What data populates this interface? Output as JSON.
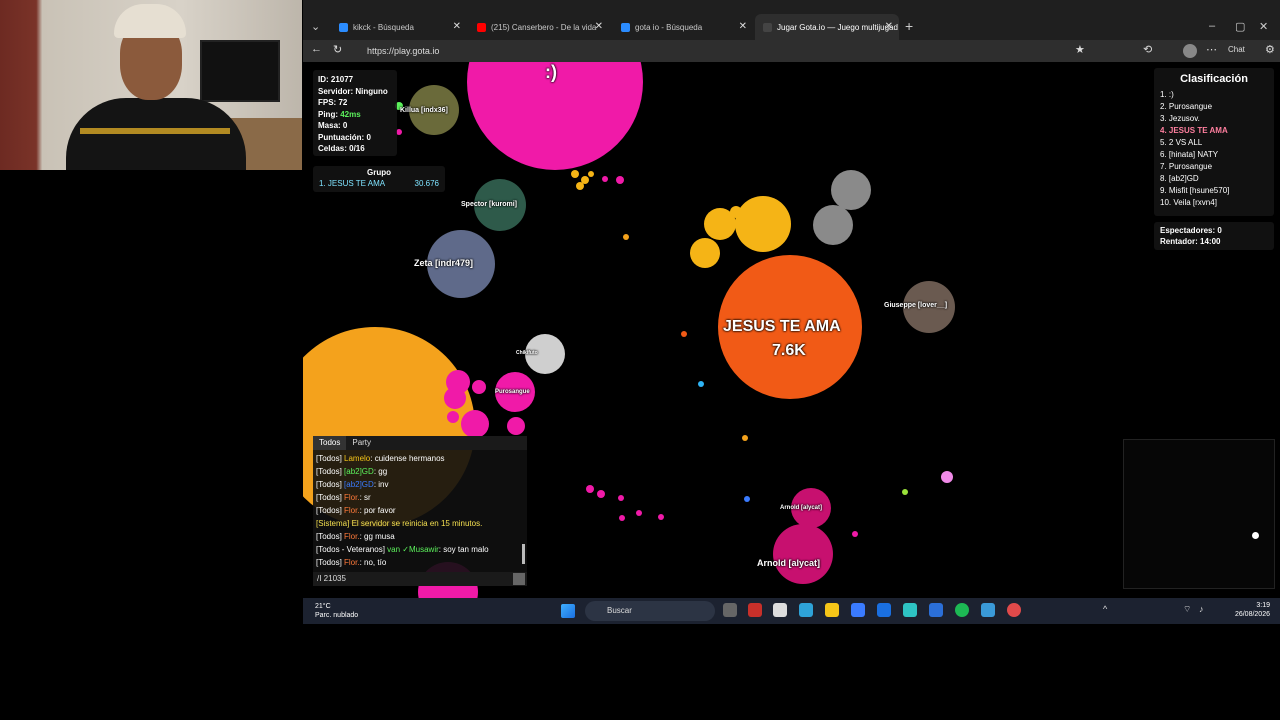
{
  "browser": {
    "tabs": [
      {
        "label": "kikck - Búsqueda",
        "icon": "bing-icon"
      },
      {
        "label": "(215) Canserbero - De la vida",
        "icon": "youtube-icon"
      },
      {
        "label": "gota io - Búsqueda",
        "icon": "bing-icon"
      },
      {
        "label": "Jugar Gota.io — Juego multijugad",
        "icon": "gota-icon"
      }
    ],
    "url": "https://play.gota.io",
    "chat_button": "Chat"
  },
  "stats": {
    "id": "ID: 21077",
    "server": "Servidor: Ninguno",
    "fps": "FPS: 72",
    "ping_label": "Ping: ",
    "ping_value": "42ms",
    "mass": "Masa: 0",
    "score": "Puntuación: 0",
    "cells": "Celdas: 0/16"
  },
  "group": {
    "title": "Grupo",
    "member": "1. JESUS TE AMA",
    "score": "30.676"
  },
  "leaderboard": {
    "title": "Clasificación",
    "entries": [
      "1. :)",
      "2. Purosangue",
      "3. Jezusov.",
      "4. JESUS TE AMA",
      "5. 2 VS ALL",
      "6. [hinata] NATY",
      "7. Purosangue",
      "8. [ab2]GD",
      "9. Misfit [hsune570]",
      "10. Veila [rxvn4]"
    ],
    "highlight_index": 3
  },
  "spectate": {
    "spectators": "Espectadores: 0",
    "restart": "Rentador: 14:00"
  },
  "cells": {
    "me_name": "JESUS TE AMA",
    "me_mass": "7.6K",
    "big_pink": ":)",
    "zeta": "Zeta [indr479]",
    "spector": "Spector [kuromi]",
    "killua": "Killua [indx36]",
    "giuseppe": "Giuseppe [lover__]",
    "arnold1": "Arnold [alycat]",
    "arnold2": "Arnold [alycat]",
    "purosangue": "Purosangue",
    "chikifuto": "Chikifuto"
  },
  "chat": {
    "tabs": [
      "Todos",
      "Party"
    ],
    "messages": [
      {
        "prefix": "[Todos] ",
        "name": "Lamelo",
        "text": ": cuidense hermanos",
        "color": "#f5c518"
      },
      {
        "prefix": "[Todos] ",
        "name": "[ab2]GD",
        "text": ": gg",
        "color": "#5cf25c"
      },
      {
        "prefix": "[Todos] ",
        "name": "[ab2]GD",
        "text": ": inv",
        "color": "#3a7bff"
      },
      {
        "prefix": "[Todos] ",
        "name": "Flor.",
        "text": ": sr",
        "color": "#ff7a3a"
      },
      {
        "prefix": "[Todos] ",
        "name": "Flor.",
        "text": ": por favor",
        "color": "#ff7a3a"
      },
      {
        "prefix": "[Sistema] ",
        "name": "",
        "text": "El servidor se reinicia en 15 minutos.",
        "color": "#f5e050"
      },
      {
        "prefix": "[Todos] ",
        "name": "Flor.",
        "text": ": gg musa",
        "color": "#ff7a3a"
      },
      {
        "prefix": "[Todos - Veteranos] ",
        "name": "van ✓Musawir",
        "text": ": soy tan malo",
        "color": "#5cf25c"
      },
      {
        "prefix": "[Todos] ",
        "name": "Flor.",
        "text": ": no, tío",
        "color": "#ff7a3a"
      }
    ],
    "input_value": "/I 21035"
  },
  "taskbar": {
    "temp": "21°C",
    "weather": "Parc. nublado",
    "search": "Buscar",
    "time": "3:19",
    "date": "26/08/2026"
  },
  "colors": {
    "me_cell": "#f15a16",
    "pink": "#f01aa8",
    "orange": "#f4a21c",
    "yellow": "#f5b416"
  }
}
